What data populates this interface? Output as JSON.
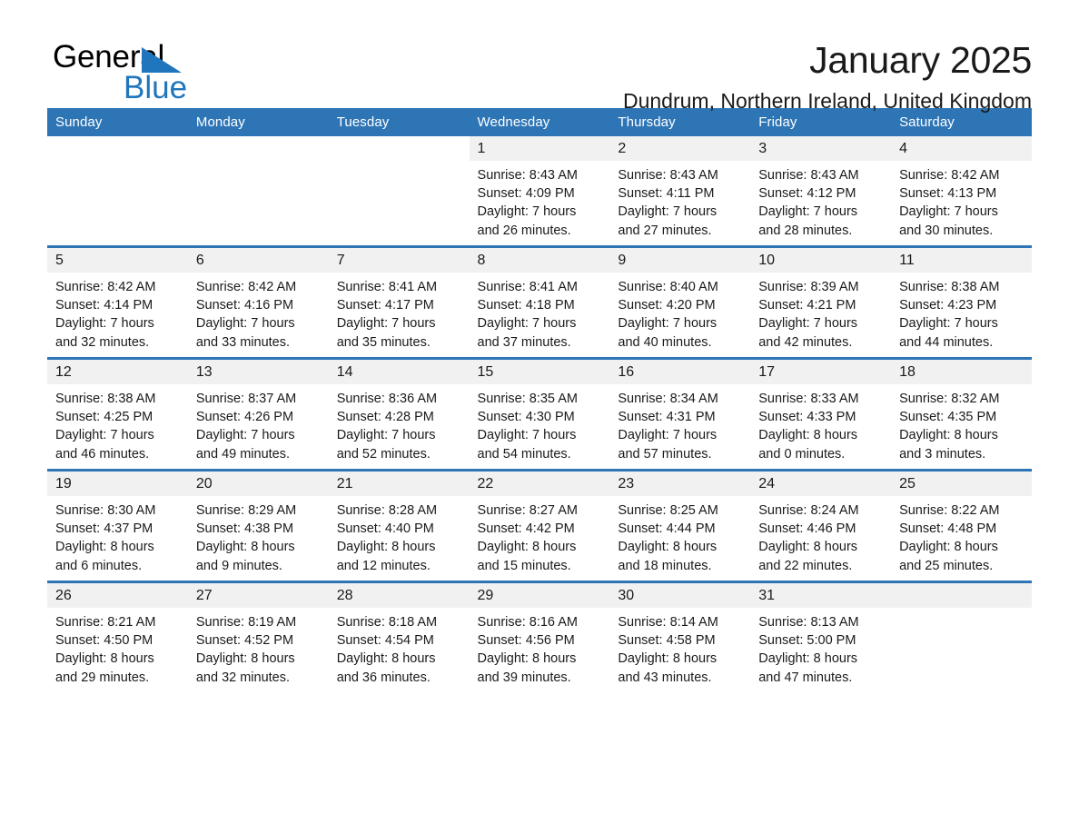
{
  "brand": {
    "name_part1": "General",
    "name_part2": "Blue",
    "accent_color": "#1f76bc"
  },
  "header": {
    "title": "January 2025",
    "location": "Dundrum, Northern Ireland, United Kingdom",
    "header_bg_color": "#2e75b6"
  },
  "calendar": {
    "weekday_headers": [
      "Sunday",
      "Monday",
      "Tuesday",
      "Wednesday",
      "Thursday",
      "Friday",
      "Saturday"
    ],
    "weeks": [
      [
        {
          "day": "",
          "sunrise": "",
          "sunset": "",
          "daylight_line1": "",
          "daylight_line2": "",
          "blank": true
        },
        {
          "day": "",
          "sunrise": "",
          "sunset": "",
          "daylight_line1": "",
          "daylight_line2": "",
          "blank": true
        },
        {
          "day": "",
          "sunrise": "",
          "sunset": "",
          "daylight_line1": "",
          "daylight_line2": "",
          "blank": true
        },
        {
          "day": "1",
          "sunrise": "Sunrise: 8:43 AM",
          "sunset": "Sunset: 4:09 PM",
          "daylight_line1": "Daylight: 7 hours",
          "daylight_line2": "and 26 minutes."
        },
        {
          "day": "2",
          "sunrise": "Sunrise: 8:43 AM",
          "sunset": "Sunset: 4:11 PM",
          "daylight_line1": "Daylight: 7 hours",
          "daylight_line2": "and 27 minutes."
        },
        {
          "day": "3",
          "sunrise": "Sunrise: 8:43 AM",
          "sunset": "Sunset: 4:12 PM",
          "daylight_line1": "Daylight: 7 hours",
          "daylight_line2": "and 28 minutes."
        },
        {
          "day": "4",
          "sunrise": "Sunrise: 8:42 AM",
          "sunset": "Sunset: 4:13 PM",
          "daylight_line1": "Daylight: 7 hours",
          "daylight_line2": "and 30 minutes."
        }
      ],
      [
        {
          "day": "5",
          "sunrise": "Sunrise: 8:42 AM",
          "sunset": "Sunset: 4:14 PM",
          "daylight_line1": "Daylight: 7 hours",
          "daylight_line2": "and 32 minutes."
        },
        {
          "day": "6",
          "sunrise": "Sunrise: 8:42 AM",
          "sunset": "Sunset: 4:16 PM",
          "daylight_line1": "Daylight: 7 hours",
          "daylight_line2": "and 33 minutes."
        },
        {
          "day": "7",
          "sunrise": "Sunrise: 8:41 AM",
          "sunset": "Sunset: 4:17 PM",
          "daylight_line1": "Daylight: 7 hours",
          "daylight_line2": "and 35 minutes."
        },
        {
          "day": "8",
          "sunrise": "Sunrise: 8:41 AM",
          "sunset": "Sunset: 4:18 PM",
          "daylight_line1": "Daylight: 7 hours",
          "daylight_line2": "and 37 minutes."
        },
        {
          "day": "9",
          "sunrise": "Sunrise: 8:40 AM",
          "sunset": "Sunset: 4:20 PM",
          "daylight_line1": "Daylight: 7 hours",
          "daylight_line2": "and 40 minutes."
        },
        {
          "day": "10",
          "sunrise": "Sunrise: 8:39 AM",
          "sunset": "Sunset: 4:21 PM",
          "daylight_line1": "Daylight: 7 hours",
          "daylight_line2": "and 42 minutes."
        },
        {
          "day": "11",
          "sunrise": "Sunrise: 8:38 AM",
          "sunset": "Sunset: 4:23 PM",
          "daylight_line1": "Daylight: 7 hours",
          "daylight_line2": "and 44 minutes."
        }
      ],
      [
        {
          "day": "12",
          "sunrise": "Sunrise: 8:38 AM",
          "sunset": "Sunset: 4:25 PM",
          "daylight_line1": "Daylight: 7 hours",
          "daylight_line2": "and 46 minutes."
        },
        {
          "day": "13",
          "sunrise": "Sunrise: 8:37 AM",
          "sunset": "Sunset: 4:26 PM",
          "daylight_line1": "Daylight: 7 hours",
          "daylight_line2": "and 49 minutes."
        },
        {
          "day": "14",
          "sunrise": "Sunrise: 8:36 AM",
          "sunset": "Sunset: 4:28 PM",
          "daylight_line1": "Daylight: 7 hours",
          "daylight_line2": "and 52 minutes."
        },
        {
          "day": "15",
          "sunrise": "Sunrise: 8:35 AM",
          "sunset": "Sunset: 4:30 PM",
          "daylight_line1": "Daylight: 7 hours",
          "daylight_line2": "and 54 minutes."
        },
        {
          "day": "16",
          "sunrise": "Sunrise: 8:34 AM",
          "sunset": "Sunset: 4:31 PM",
          "daylight_line1": "Daylight: 7 hours",
          "daylight_line2": "and 57 minutes."
        },
        {
          "day": "17",
          "sunrise": "Sunrise: 8:33 AM",
          "sunset": "Sunset: 4:33 PM",
          "daylight_line1": "Daylight: 8 hours",
          "daylight_line2": "and 0 minutes."
        },
        {
          "day": "18",
          "sunrise": "Sunrise: 8:32 AM",
          "sunset": "Sunset: 4:35 PM",
          "daylight_line1": "Daylight: 8 hours",
          "daylight_line2": "and 3 minutes."
        }
      ],
      [
        {
          "day": "19",
          "sunrise": "Sunrise: 8:30 AM",
          "sunset": "Sunset: 4:37 PM",
          "daylight_line1": "Daylight: 8 hours",
          "daylight_line2": "and 6 minutes."
        },
        {
          "day": "20",
          "sunrise": "Sunrise: 8:29 AM",
          "sunset": "Sunset: 4:38 PM",
          "daylight_line1": "Daylight: 8 hours",
          "daylight_line2": "and 9 minutes."
        },
        {
          "day": "21",
          "sunrise": "Sunrise: 8:28 AM",
          "sunset": "Sunset: 4:40 PM",
          "daylight_line1": "Daylight: 8 hours",
          "daylight_line2": "and 12 minutes."
        },
        {
          "day": "22",
          "sunrise": "Sunrise: 8:27 AM",
          "sunset": "Sunset: 4:42 PM",
          "daylight_line1": "Daylight: 8 hours",
          "daylight_line2": "and 15 minutes."
        },
        {
          "day": "23",
          "sunrise": "Sunrise: 8:25 AM",
          "sunset": "Sunset: 4:44 PM",
          "daylight_line1": "Daylight: 8 hours",
          "daylight_line2": "and 18 minutes."
        },
        {
          "day": "24",
          "sunrise": "Sunrise: 8:24 AM",
          "sunset": "Sunset: 4:46 PM",
          "daylight_line1": "Daylight: 8 hours",
          "daylight_line2": "and 22 minutes."
        },
        {
          "day": "25",
          "sunrise": "Sunrise: 8:22 AM",
          "sunset": "Sunset: 4:48 PM",
          "daylight_line1": "Daylight: 8 hours",
          "daylight_line2": "and 25 minutes."
        }
      ],
      [
        {
          "day": "26",
          "sunrise": "Sunrise: 8:21 AM",
          "sunset": "Sunset: 4:50 PM",
          "daylight_line1": "Daylight: 8 hours",
          "daylight_line2": "and 29 minutes."
        },
        {
          "day": "27",
          "sunrise": "Sunrise: 8:19 AM",
          "sunset": "Sunset: 4:52 PM",
          "daylight_line1": "Daylight: 8 hours",
          "daylight_line2": "and 32 minutes."
        },
        {
          "day": "28",
          "sunrise": "Sunrise: 8:18 AM",
          "sunset": "Sunset: 4:54 PM",
          "daylight_line1": "Daylight: 8 hours",
          "daylight_line2": "and 36 minutes."
        },
        {
          "day": "29",
          "sunrise": "Sunrise: 8:16 AM",
          "sunset": "Sunset: 4:56 PM",
          "daylight_line1": "Daylight: 8 hours",
          "daylight_line2": "and 39 minutes."
        },
        {
          "day": "30",
          "sunrise": "Sunrise: 8:14 AM",
          "sunset": "Sunset: 4:58 PM",
          "daylight_line1": "Daylight: 8 hours",
          "daylight_line2": "and 43 minutes."
        },
        {
          "day": "31",
          "sunrise": "Sunrise: 8:13 AM",
          "sunset": "Sunset: 5:00 PM",
          "daylight_line1": "Daylight: 8 hours",
          "daylight_line2": "and 47 minutes."
        },
        {
          "day": "",
          "sunrise": "",
          "sunset": "",
          "daylight_line1": "",
          "daylight_line2": "",
          "empty": true
        }
      ]
    ]
  }
}
